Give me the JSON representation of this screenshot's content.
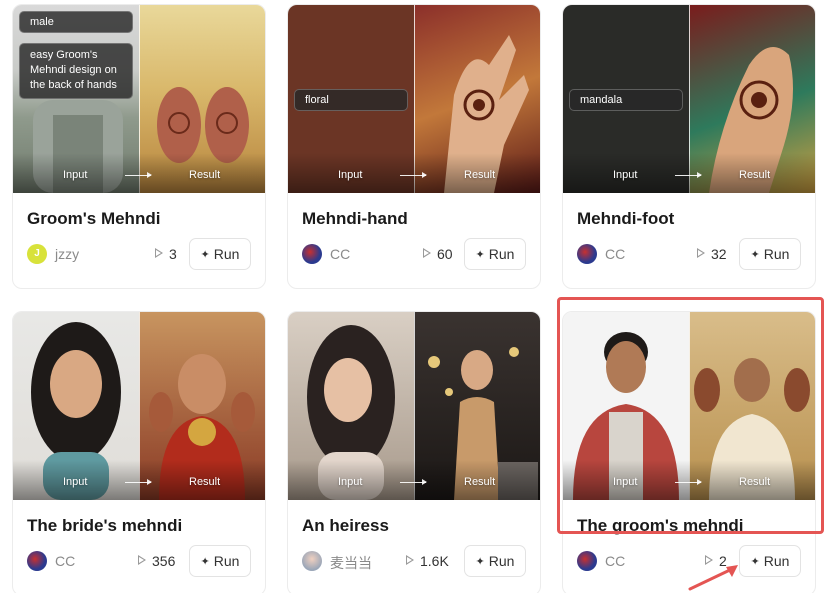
{
  "cards": [
    {
      "title": "Groom's Mehndi",
      "author": "jzzy",
      "plays": "3",
      "run_label": "Run",
      "input_label": "Input",
      "result_label": "Result",
      "tags": [
        "male",
        "easy Groom's Mehndi design on the back of hands"
      ]
    },
    {
      "title": "Mehndi-hand",
      "author": "CC",
      "plays": "60",
      "run_label": "Run",
      "input_label": "Input",
      "result_label": "Result",
      "tags": [
        "floral"
      ]
    },
    {
      "title": "Mehndi-foot",
      "author": "CC",
      "plays": "32",
      "run_label": "Run",
      "input_label": "Input",
      "result_label": "Result",
      "tags": [
        "mandala"
      ]
    },
    {
      "title": "The bride's mehndi",
      "author": "CC",
      "plays": "356",
      "run_label": "Run",
      "input_label": "Input",
      "result_label": "Result",
      "tags": []
    },
    {
      "title": "An heiress",
      "author": "麦当当",
      "plays": "1.6K",
      "run_label": "Run",
      "input_label": "Input",
      "result_label": "Result",
      "tags": []
    },
    {
      "title": "The groom's mehndi",
      "author": "CC",
      "plays": "2",
      "run_label": "Run",
      "input_label": "Input",
      "result_label": "Result",
      "tags": []
    }
  ],
  "colors": {
    "highlight": "#e45553",
    "avatar_jzzy": "#d8e23a",
    "avatar_cc": "#2b3a8f"
  }
}
